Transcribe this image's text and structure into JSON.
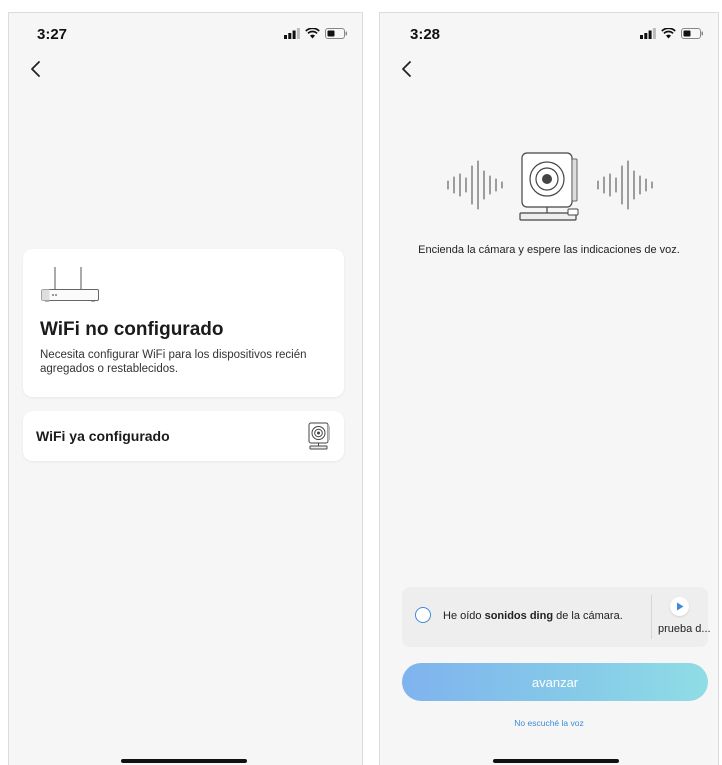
{
  "left_screen": {
    "status": {
      "time": "3:27"
    },
    "card_not_configured": {
      "title": "WiFi no configurado",
      "description": "Necesita configurar WiFi para los dispositivos recién agregados o restablecidos."
    },
    "card_configured": {
      "label": "WiFi ya configurado"
    }
  },
  "right_screen": {
    "status": {
      "time": "3:28"
    },
    "instruction": "Encienda la cámara y espere las indicaciones de voz.",
    "confirm": {
      "text_before": "He oído ",
      "text_bold": "sonidos ding",
      "text_after": " de la cámara.",
      "play_label": "prueba d..."
    },
    "advance_button": "avanzar",
    "no_voice_link": "No escuché la voz"
  },
  "colors": {
    "accent_blue": "#3d8bd8",
    "button_gradient_start": "#7fb3ee",
    "button_gradient_end": "#8fdde6",
    "screen_background": "#f6f6f6"
  }
}
